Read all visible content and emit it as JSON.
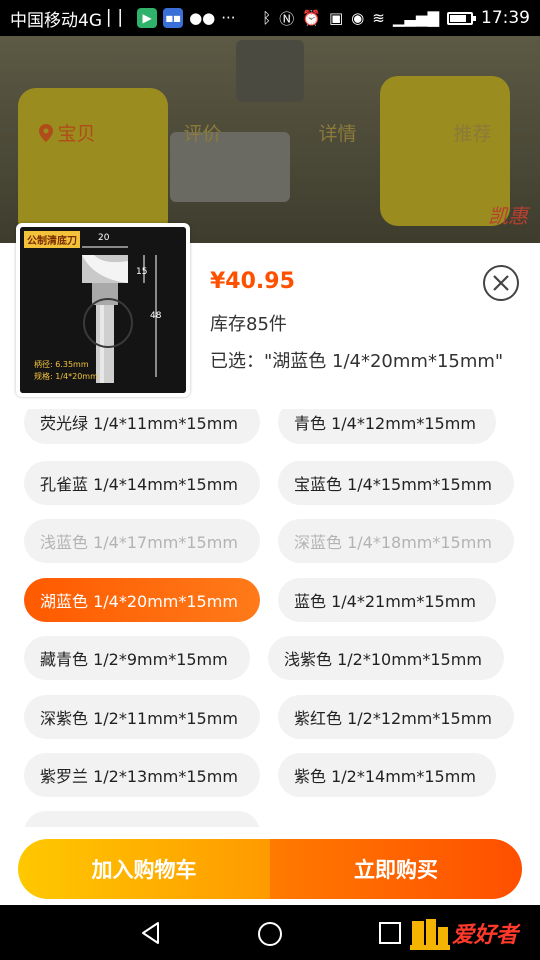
{
  "status_bar": {
    "carrier": "中国移动4G",
    "time": "17:39",
    "icons": [
      "hd-audio-icon",
      "media-app-icon",
      "news-app-icon",
      "wechat-icon",
      "more-icon",
      "bluetooth-icon",
      "nfc-icon",
      "alarm-icon",
      "hd-icon",
      "eye-icon",
      "wifi-icon",
      "signal-icon",
      "battery-icon"
    ]
  },
  "background": {
    "tabs": [
      {
        "label": "宝贝",
        "active": true
      },
      {
        "label": "评价",
        "active": false
      },
      {
        "label": "详情",
        "active": false
      },
      {
        "label": "推荐",
        "active": false
      }
    ],
    "logo_text": "凯惠"
  },
  "product": {
    "thumb_tag": "公制清底刀",
    "thumb_dim_top": "20",
    "thumb_dim_side1": "15",
    "thumb_dim_side2": "48",
    "thumb_spec1": "柄径: 6.35mm",
    "thumb_spec2": "规格: 1/4*20mm",
    "price": "¥40.95",
    "stock": "库存85件",
    "selected": "已选：\"湖蓝色 1/4*20mm*15mm\""
  },
  "options": [
    {
      "label": "荧光绿 1/4*11mm*15mm",
      "state": "normal"
    },
    {
      "label": "青色 1/4*12mm*15mm",
      "state": "normal"
    },
    {
      "label": "孔雀蓝 1/4*14mm*15mm",
      "state": "normal"
    },
    {
      "label": "宝蓝色 1/4*15mm*15mm",
      "state": "normal"
    },
    {
      "label": "浅蓝色 1/4*17mm*15mm",
      "state": "disabled"
    },
    {
      "label": "深蓝色 1/4*18mm*15mm",
      "state": "disabled"
    },
    {
      "label": "湖蓝色 1/4*20mm*15mm",
      "state": "selected"
    },
    {
      "label": "蓝色 1/4*21mm*15mm",
      "state": "normal"
    },
    {
      "label": "藏青色 1/2*9mm*15mm",
      "state": "normal"
    },
    {
      "label": "浅紫色 1/2*10mm*15mm",
      "state": "normal"
    },
    {
      "label": "深紫色 1/2*11mm*15mm",
      "state": "normal"
    },
    {
      "label": "紫红色 1/2*12mm*15mm",
      "state": "normal"
    },
    {
      "label": "紫罗兰 1/2*13mm*15mm",
      "state": "normal"
    },
    {
      "label": "紫色 1/2*14mm*15mm",
      "state": "normal"
    }
  ],
  "actions": {
    "add_to_cart": "加入购物车",
    "buy_now": "立即购买"
  },
  "brand": {
    "text": "爱好者"
  },
  "colors": {
    "accent": "#ff5000",
    "cart_button": "#ffb000",
    "buy_button": "#ff5a00"
  }
}
